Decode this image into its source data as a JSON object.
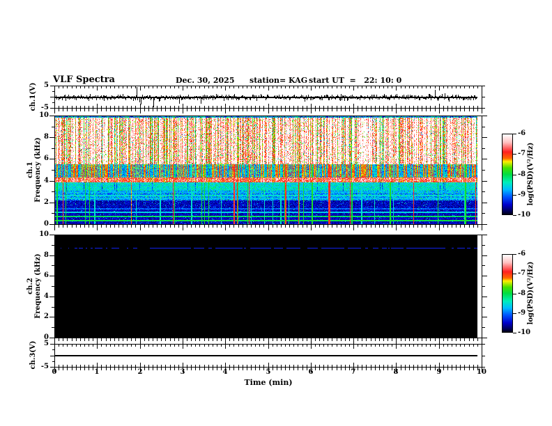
{
  "title": {
    "name": "VLF Spectra",
    "date": "Dec. 30, 2025",
    "station": "station= KAG",
    "start_ut": "start UT  =   22: 10: 0"
  },
  "x_axis": {
    "label": "Time (min)",
    "range": [
      0,
      10
    ],
    "major_ticks": [
      0,
      1,
      2,
      3,
      4,
      5,
      6,
      7,
      8,
      9,
      10
    ],
    "minor_step": 0.1
  },
  "panels": {
    "ch1_wave": {
      "name": "ch.1(V)",
      "ylim": [
        -5,
        5
      ],
      "ytick_labels": [
        {
          "v": 5,
          "t": "5"
        },
        {
          "v": -5,
          "t": "-5"
        }
      ]
    },
    "ch1_spec": {
      "name_line1": "ch.1",
      "name_line2": "Frequency (kHz)",
      "ylim": [
        0,
        10
      ],
      "major_yticks": [
        0,
        2,
        4,
        6,
        8,
        10
      ],
      "minor_yticks": [
        1,
        3,
        5,
        7,
        9
      ]
    },
    "ch2_spec": {
      "name_line1": "ch.2",
      "name_line2": "Frequency (kHz)",
      "ylim": [
        0,
        10
      ],
      "major_yticks": [
        0,
        2,
        4,
        6,
        8,
        10
      ],
      "minor_yticks": [
        1,
        3,
        5,
        7,
        9
      ]
    },
    "ch3_wave": {
      "name": "ch.3(V)",
      "ylim": [
        -5,
        5
      ],
      "ytick_labels": [
        {
          "v": 5,
          "t": "5"
        },
        {
          "v": -5,
          "t": "-5"
        }
      ]
    }
  },
  "colorbar": {
    "label": "log(PSD)(V²/Hz)",
    "tick_labels": [
      "-6",
      "-7",
      "-8",
      "-9",
      "-10"
    ],
    "range": [
      -6,
      -10
    ],
    "gradient": [
      [
        1.0,
        "#ffffff"
      ],
      [
        0.9,
        "#ffc2c2"
      ],
      [
        0.78,
        "#ff2020"
      ],
      [
        0.7,
        "#ff6600"
      ],
      [
        0.66,
        "#ffee00"
      ],
      [
        0.58,
        "#44e000"
      ],
      [
        0.5,
        "#00dd44"
      ],
      [
        0.4,
        "#00eebb"
      ],
      [
        0.31,
        "#00bbff"
      ],
      [
        0.22,
        "#0055ff"
      ],
      [
        0.12,
        "#0000cc"
      ],
      [
        0.05,
        "#000066"
      ],
      [
        0.0,
        "#000014"
      ]
    ]
  },
  "chart_data": [
    {
      "type": "line",
      "panel": "ch.1(V)",
      "xlim": [
        0,
        10
      ],
      "ylim": [
        -5,
        5
      ],
      "description": "noisy waveform near 0 V with impulsive spikes",
      "noise_v": 0.35,
      "spikes": [
        {
          "t": 1.15,
          "v": -1.6
        },
        {
          "t": 1.93,
          "v": 4.6
        },
        {
          "t": 2.33,
          "v": -4.4
        },
        {
          "t": 3.45,
          "v": -2.9
        },
        {
          "t": 4.1,
          "v": -1.2
        },
        {
          "t": 5.9,
          "v": -1.9
        },
        {
          "t": 7.55,
          "v": 1.1
        },
        {
          "t": 9.0,
          "v": 3.2
        }
      ]
    },
    {
      "type": "heatmap",
      "panel": "ch.1 spectrogram",
      "xlim": [
        0,
        10
      ],
      "ylim": [
        0,
        10
      ],
      "ylabel": "Frequency (kHz)",
      "zlabel": "log(PSD)(V²/Hz)",
      "zlim": [
        -10,
        -6
      ],
      "features": {
        "active_band_khz": [
          5.6,
          10
        ],
        "quiet_blue_band_khz": [
          4.35,
          5.6
        ],
        "bright_red_band_khz": [
          3.9,
          4.35
        ],
        "green_band_khz": [
          3.1,
          3.9
        ],
        "h_lines": [
          {
            "f_khz": 0.35,
            "psd": -8.0
          },
          {
            "f_khz": 0.75,
            "psd": -8.1
          },
          {
            "f_khz": 1.1,
            "psd": -8.6
          },
          {
            "f_khz": 1.45,
            "psd": -9.1
          },
          {
            "f_khz": 2.45,
            "psd": -8.75
          },
          {
            "f_khz": 2.7,
            "psd": -8.55
          },
          {
            "f_khz": 3.0,
            "psd": -8.75
          }
        ],
        "vertical_streaks": "dense impulsive full-height colored streaks, ~46 narrow lines below 5.6 kHz"
      }
    },
    {
      "type": "heatmap",
      "panel": "ch.2 spectrogram",
      "xlim": [
        0,
        10
      ],
      "ylim": [
        0,
        10
      ],
      "ylabel": "Frequency (kHz)",
      "zlabel": "log(PSD)(V²/Hz)",
      "zlim": [
        -10,
        -6
      ],
      "background_psd": -10,
      "h_lines": [
        {
          "f_khz": 8.8,
          "psd": -9.3,
          "style": "intermittent blue dashed line"
        }
      ]
    },
    {
      "type": "line",
      "panel": "ch.3(V)",
      "xlim": [
        0,
        10
      ],
      "ylim": [
        -5,
        5
      ],
      "description": "flat line at 0 V",
      "value": 0
    }
  ]
}
